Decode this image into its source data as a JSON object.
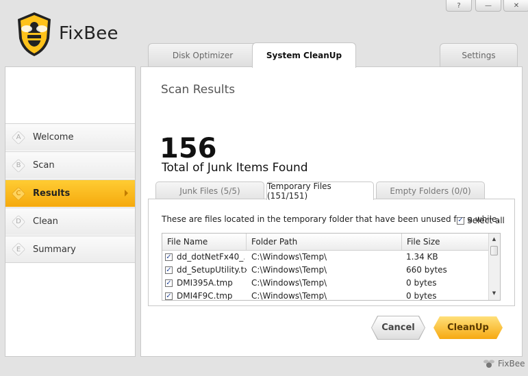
{
  "app": {
    "name": "FixBee",
    "footer_name": "FixBee"
  },
  "window_controls": {
    "help": "?",
    "minimize": "—",
    "close": "✕"
  },
  "top_tabs": [
    {
      "label": "Disk Optimizer",
      "active": false
    },
    {
      "label": "System CleanUp",
      "active": true
    },
    {
      "label": "Settings",
      "active": false
    }
  ],
  "sidebar": {
    "items": [
      {
        "letter": "A",
        "label": "Welcome",
        "active": false
      },
      {
        "letter": "B",
        "label": "Scan",
        "active": false
      },
      {
        "letter": "C",
        "label": "Results",
        "active": true
      },
      {
        "letter": "D",
        "label": "Clean",
        "active": false
      },
      {
        "letter": "E",
        "label": "Summary",
        "active": false
      }
    ]
  },
  "main": {
    "title": "Scan Results",
    "total_count": "156",
    "total_label": "Total of Junk Items Found",
    "tabs": [
      {
        "label": "Junk Files (5/5)",
        "active": false
      },
      {
        "label": "Temporary Files (151/151)",
        "active": true
      },
      {
        "label": "Empty Folders (0/0)",
        "active": false
      }
    ],
    "description": "These are files located in the temporary folder that have been unused for a while.",
    "select_all_label": "Select all",
    "select_all_checked": true,
    "table": {
      "columns": [
        "File Name",
        "Folder Path",
        "File Size"
      ],
      "rows": [
        {
          "checked": true,
          "name": "dd_dotNetFx40_...",
          "path": "C:\\Windows\\Temp\\",
          "size": "1.34 KB"
        },
        {
          "checked": true,
          "name": "dd_SetupUtility.txt",
          "path": "C:\\Windows\\Temp\\",
          "size": "660 bytes"
        },
        {
          "checked": true,
          "name": "DMI395A.tmp",
          "path": "C:\\Windows\\Temp\\",
          "size": "0 bytes"
        },
        {
          "checked": true,
          "name": "DMI4F9C.tmp",
          "path": "C:\\Windows\\Temp\\",
          "size": "0 bytes"
        }
      ]
    }
  },
  "buttons": {
    "cancel": "Cancel",
    "cleanup": "CleanUp"
  },
  "colors": {
    "accent": "#f6b21d",
    "accent_light": "#ffd35c"
  }
}
